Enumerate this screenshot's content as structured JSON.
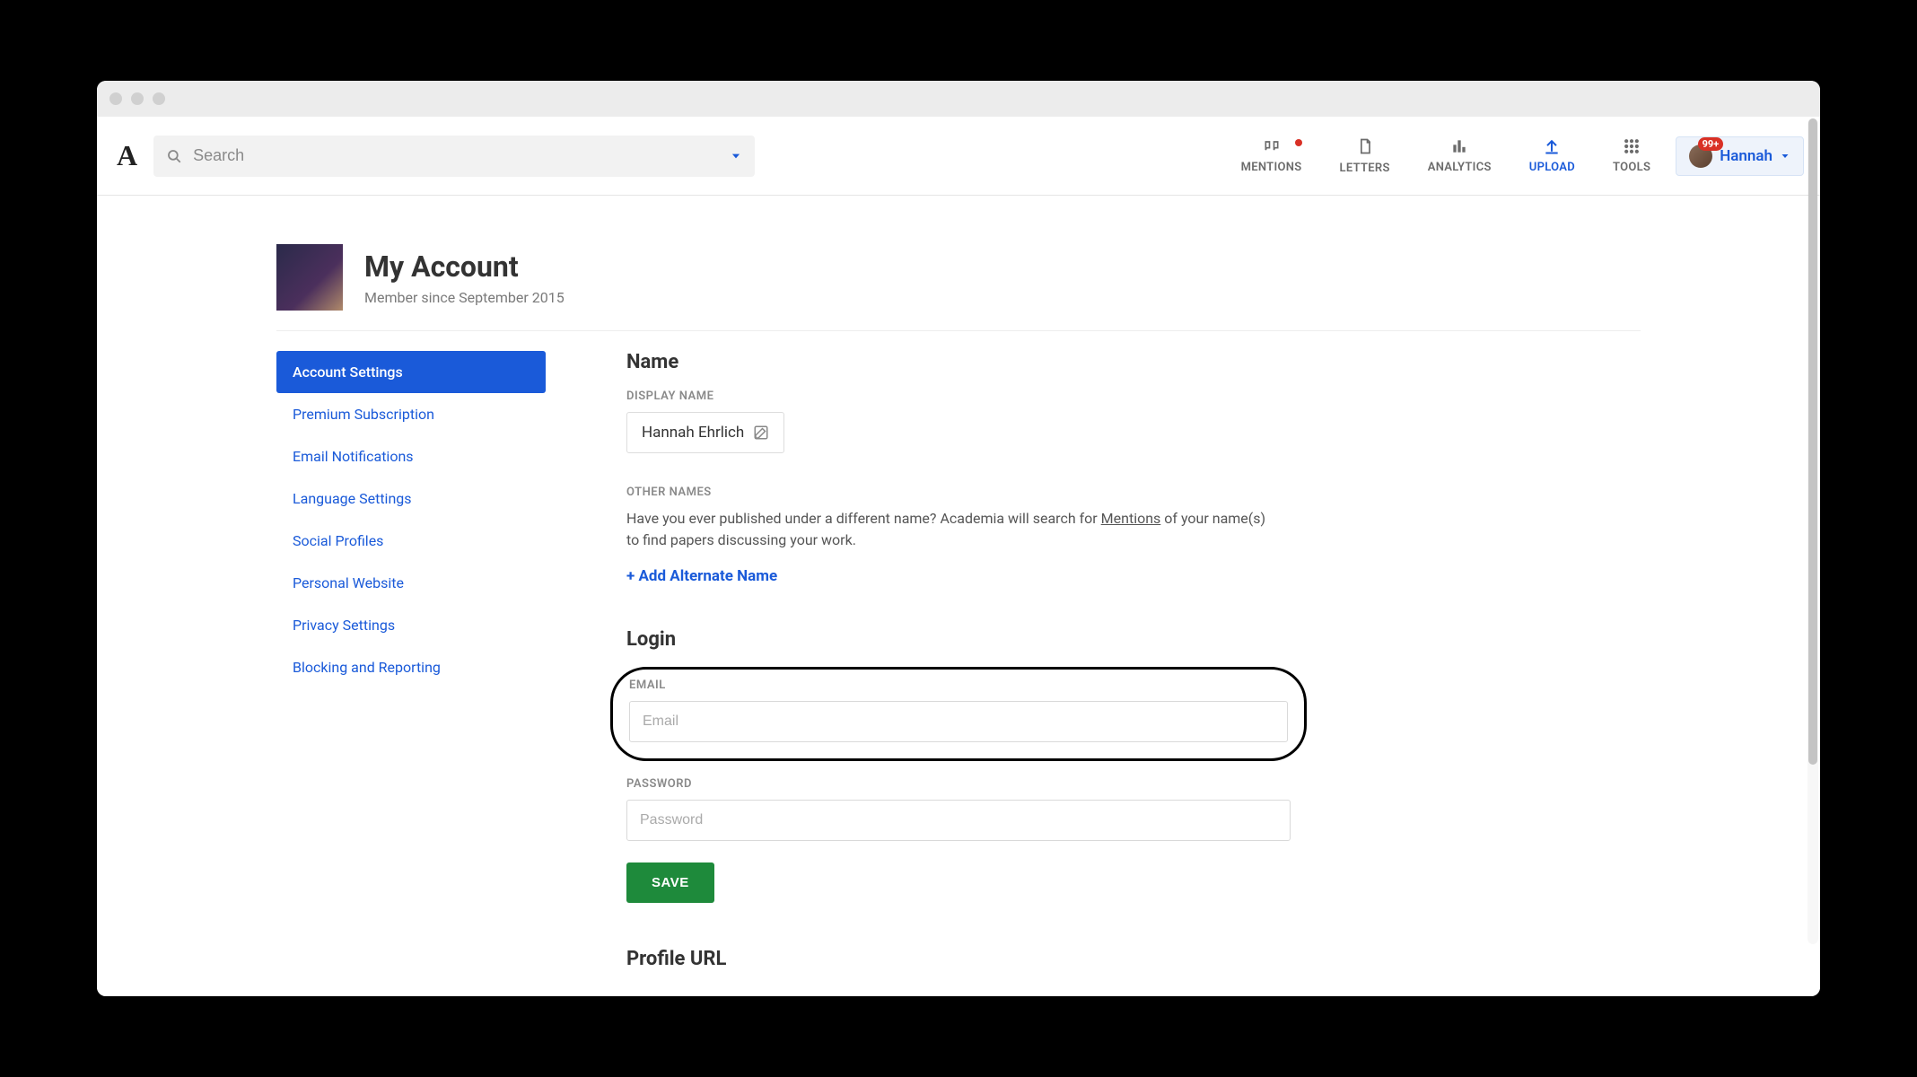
{
  "search": {
    "placeholder": "Search"
  },
  "nav": {
    "mentions": "MENTIONS",
    "letters": "LETTERS",
    "analytics": "ANALYTICS",
    "upload": "UPLOAD",
    "tools": "TOOLS"
  },
  "user": {
    "name": "Hannah",
    "badge": "99+"
  },
  "page": {
    "title": "My Account",
    "member_since": "Member since September 2015"
  },
  "sidebar": {
    "items": [
      "Account Settings",
      "Premium Subscription",
      "Email Notifications",
      "Language Settings",
      "Social Profiles",
      "Personal Website",
      "Privacy Settings",
      "Blocking and Reporting"
    ],
    "active_index": 0
  },
  "name_section": {
    "heading": "Name",
    "display_name_label": "DISPLAY NAME",
    "display_name": "Hannah Ehrlich",
    "other_names_label": "OTHER NAMES",
    "other_names_help_pre": "Have you ever published under a different name? Academia will search for ",
    "other_names_link": "Mentions",
    "other_names_help_post": " of your name(s) to find papers discussing your work.",
    "add_alternate": "+ Add Alternate Name"
  },
  "login_section": {
    "heading": "Login",
    "email_label": "EMAIL",
    "email_placeholder": "Email",
    "password_label": "PASSWORD",
    "password_placeholder": "Password",
    "save": "SAVE"
  },
  "profile_url_section": {
    "heading": "Profile URL"
  }
}
